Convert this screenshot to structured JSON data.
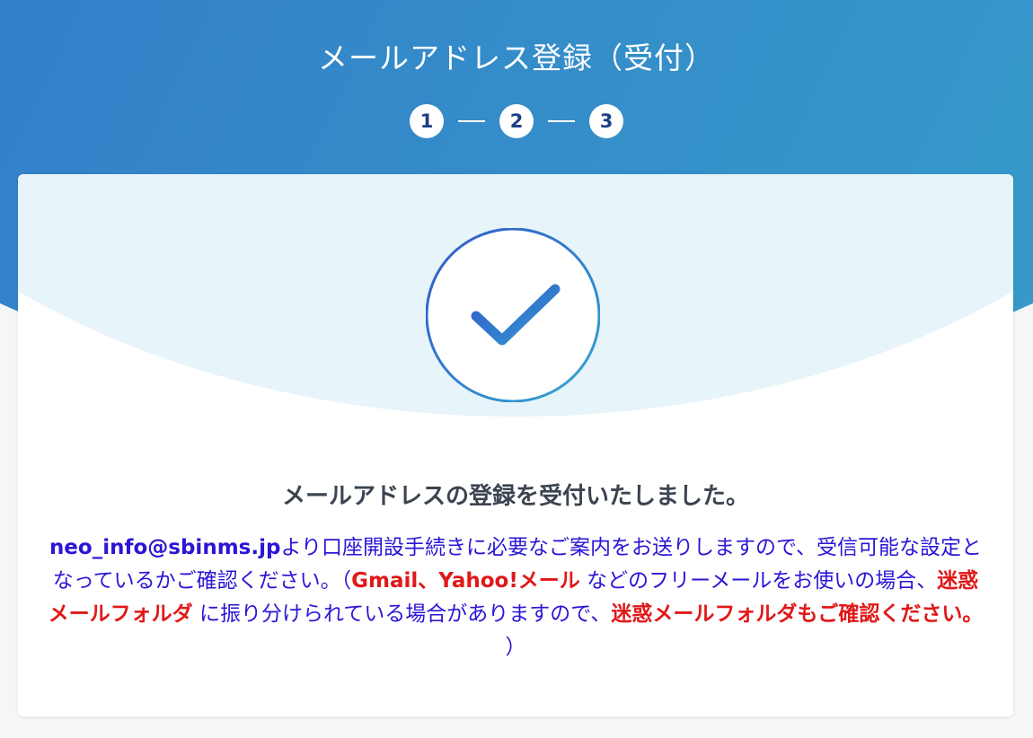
{
  "header": {
    "title": "メールアドレス登録（受付）",
    "steps": [
      "1",
      "2",
      "3"
    ]
  },
  "icons": {
    "success": "checkmark-icon"
  },
  "colors": {
    "header_gradient_start": "#2f62cf",
    "header_gradient_end": "#37a6c9",
    "notice_text": "#2a16d6",
    "warning_text": "#e01818",
    "message_text": "#3b4450"
  },
  "card": {
    "message": "メールアドレスの登録を受付いたしました。",
    "notice": {
      "email": "neo_info@sbinms.jp",
      "part1": "より口座開設手続きに必要なご案内をお送りしますので、受信可能な設定となっているかご確認ください。（",
      "highlight1": "Gmail、Yahoo!メール",
      "part2": " などのフリーメールをお使いの場合、",
      "highlight2": "迷惑メールフォルダ",
      "part3": " に振り分けられている場合がありますので、",
      "highlight3": "迷惑メールフォルダもご確認ください。",
      "part4": " ）"
    }
  }
}
